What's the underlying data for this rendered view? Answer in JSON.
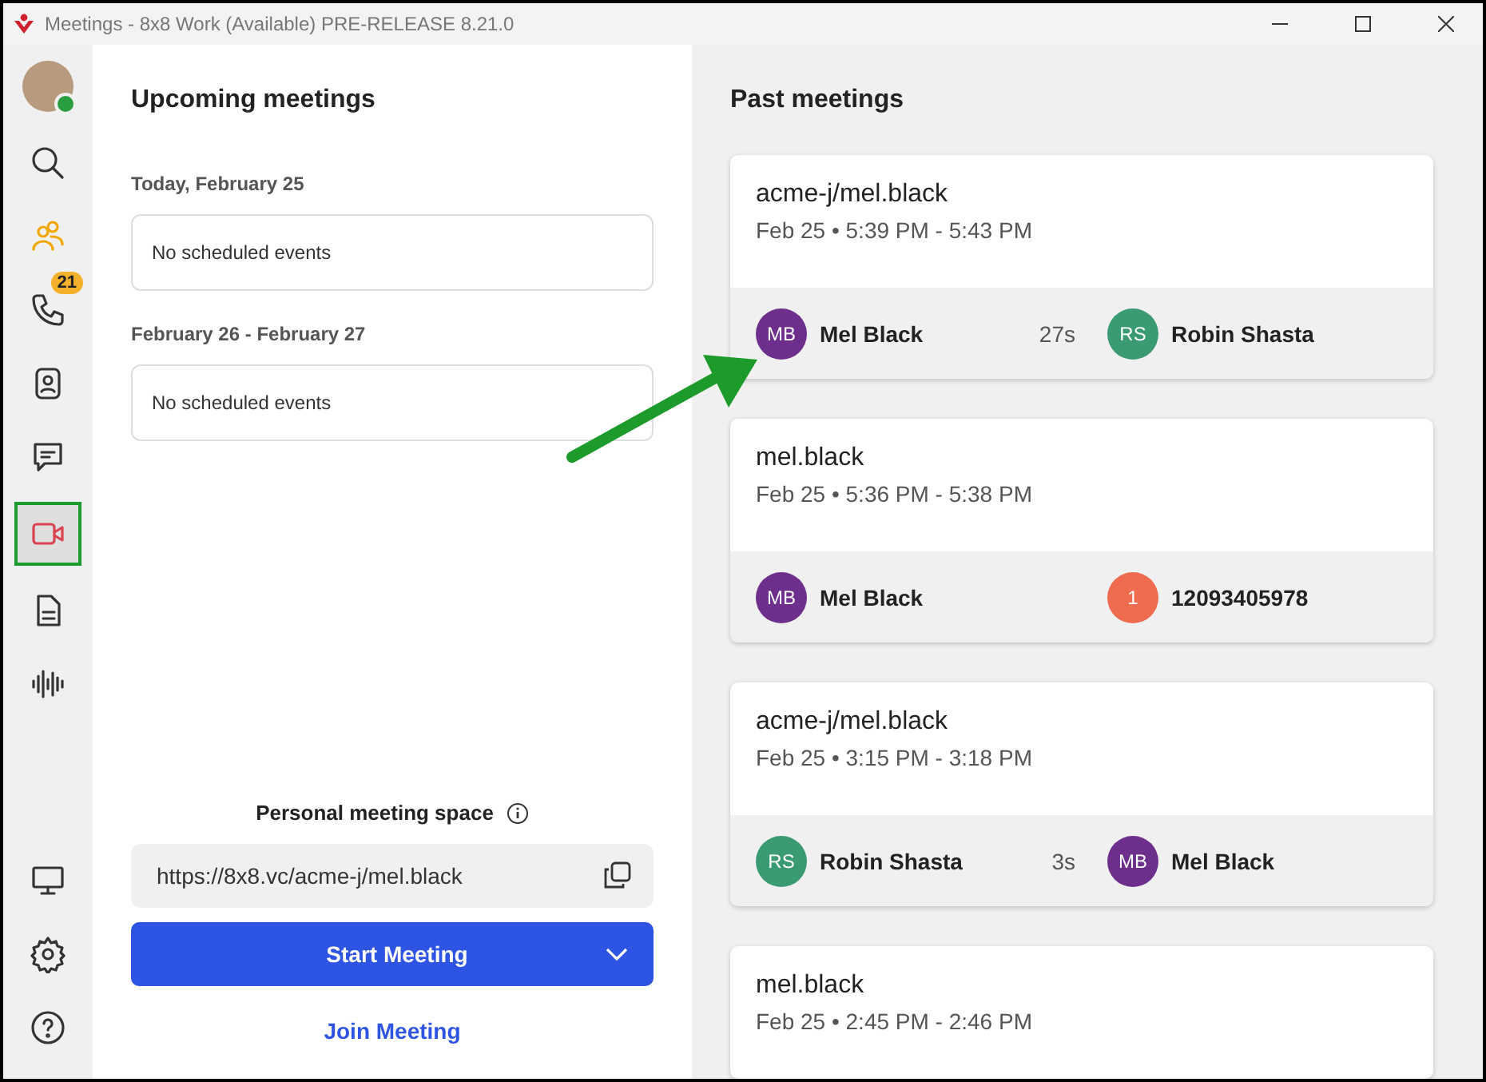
{
  "window": {
    "title": "Meetings - 8x8 Work (Available) PRE-RELEASE 8.21.0"
  },
  "sidebar": {
    "online": true,
    "items": [
      {
        "kind": "search",
        "selected": false,
        "outlined": false
      },
      {
        "kind": "people",
        "selected": false,
        "outlined": false
      },
      {
        "kind": "phone",
        "selected": false,
        "outlined": false,
        "badge": "21"
      },
      {
        "kind": "contacts",
        "selected": false,
        "outlined": false
      },
      {
        "kind": "chat",
        "selected": false,
        "outlined": false
      },
      {
        "kind": "video",
        "selected": true,
        "outlined": true
      },
      {
        "kind": "document",
        "selected": false,
        "outlined": false
      },
      {
        "kind": "waveform",
        "selected": false,
        "outlined": false
      }
    ],
    "bottom_items": [
      {
        "kind": "monitor"
      },
      {
        "kind": "settings"
      },
      {
        "kind": "help"
      }
    ]
  },
  "upcoming": {
    "title": "Upcoming meetings",
    "groups": [
      {
        "label": "Today, February 25",
        "message": "No scheduled events"
      },
      {
        "label": "February 26 - February 27",
        "message": "No scheduled events"
      }
    ],
    "personal_space": {
      "label": "Personal meeting space",
      "url": "https://8x8.vc/acme-j/mel.black"
    },
    "start_button": "Start Meeting",
    "join_link": "Join Meeting"
  },
  "past": {
    "title": "Past meetings",
    "meetings": [
      {
        "title": "acme-j/mel.black",
        "time": "Feb 25 • 5:39 PM - 5:43 PM",
        "duration": "27s",
        "participants": [
          {
            "initials": "MB",
            "name": "Mel Black",
            "color": "#6e2f8c"
          },
          {
            "initials": "RS",
            "name": "Robin Shasta",
            "color": "#3a9b72"
          }
        ]
      },
      {
        "title": "mel.black",
        "time": "Feb 25 • 5:36 PM - 5:38 PM",
        "participants": [
          {
            "initials": "MB",
            "name": "Mel Black",
            "color": "#6e2f8c"
          },
          {
            "initials": "1",
            "name": "12093405978",
            "color": "#ef6b4f"
          }
        ]
      },
      {
        "title": "acme-j/mel.black",
        "time": "Feb 25 • 3:15 PM - 3:18 PM",
        "duration": "3s",
        "participants": [
          {
            "initials": "RS",
            "name": "Robin Shasta",
            "color": "#3a9b72"
          },
          {
            "initials": "MB",
            "name": "Mel Black",
            "color": "#6e2f8c"
          }
        ]
      },
      {
        "title": "mel.black",
        "time": "Feb 25 • 2:45 PM - 2:46 PM"
      }
    ]
  },
  "annotations": [
    {
      "kind": "arrow"
    }
  ]
}
